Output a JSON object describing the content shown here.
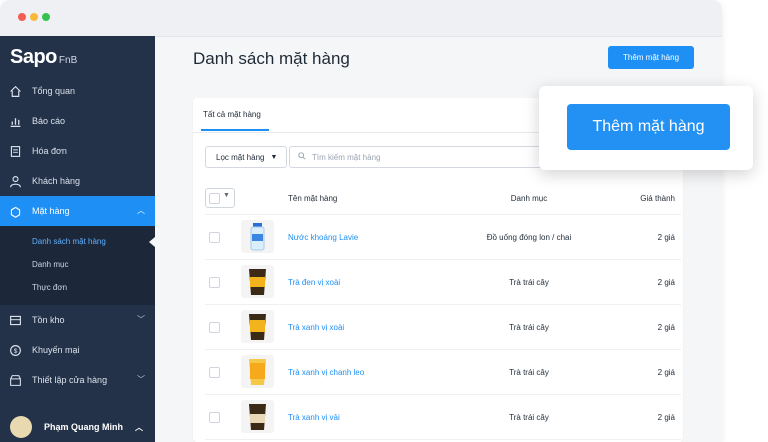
{
  "app": {
    "logo_main": "Sapo",
    "logo_sub": "FnB"
  },
  "window": {
    "dots": [
      "#f45b53",
      "#f6b93b",
      "#36c24f"
    ]
  },
  "sidebar": {
    "items": [
      {
        "label": "Tổng quan",
        "icon": "home-icon"
      },
      {
        "label": "Báo cáo",
        "icon": "report-icon"
      },
      {
        "label": "Hóa đơn",
        "icon": "invoice-icon"
      },
      {
        "label": "Khách hàng",
        "icon": "user-icon"
      },
      {
        "label": "Mặt hàng",
        "icon": "product-icon",
        "active": true,
        "chevron": "^"
      }
    ],
    "subitems": [
      {
        "label": "Danh sách mặt hàng",
        "active": true
      },
      {
        "label": "Danh mục"
      },
      {
        "label": "Thực đơn"
      }
    ],
    "items2": [
      {
        "label": "Tồn kho",
        "icon": "warehouse-icon",
        "chevron": "v"
      },
      {
        "label": "Khuyến mại",
        "icon": "promo-icon"
      },
      {
        "label": "Thiết lập cửa hàng",
        "icon": "store-settings-icon",
        "chevron": "v"
      }
    ],
    "user": {
      "name": "Phạm Quang Minh",
      "chevron": "^"
    }
  },
  "main": {
    "title": "Danh sách mặt hàng",
    "add_button": "Thêm mặt hàng",
    "tab_all": "Tất cả mặt hàng",
    "filter_label": "Lọc mặt hàng",
    "search_placeholder": "Tìm kiếm mặt hàng",
    "columns": {
      "name": "Tên mặt hàng",
      "category": "Danh mục",
      "price": "Giá thành"
    },
    "rows": [
      {
        "name": "Nước khoáng Lavie",
        "category": "Đồ uống đóng lon / chai",
        "price": "2 giá",
        "thumb": "bottle"
      },
      {
        "name": "Trà đen vị xoài",
        "category": "Trà trái cây",
        "price": "2 giá",
        "thumb": "cup-dark"
      },
      {
        "name": "Trà xanh vị xoài",
        "category": "Trà trái cây",
        "price": "2 giá",
        "thumb": "cup-dark"
      },
      {
        "name": "Trà xanh vị chanh leo",
        "category": "Trà trái cây",
        "price": "2 giá",
        "thumb": "cup-yellow"
      },
      {
        "name": "Trà xanh vị vải",
        "category": "Trà trái cây",
        "price": "2 giá",
        "thumb": "cup-dark"
      }
    ]
  },
  "popup": {
    "button": "Thêm mặt hàng"
  },
  "colors": {
    "accent": "#1e8ff5",
    "sidebar": "#243249"
  }
}
